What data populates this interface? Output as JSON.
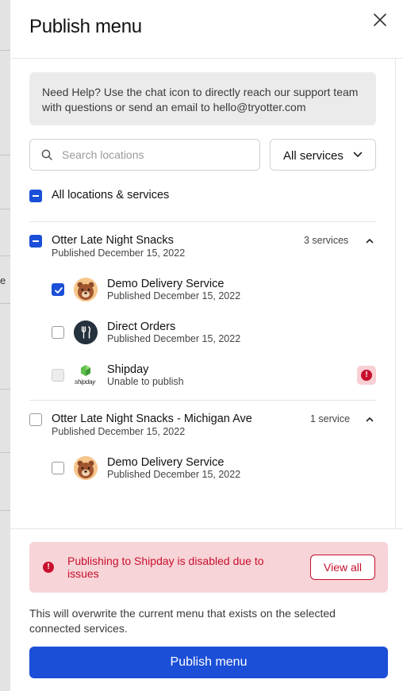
{
  "backdrop": {
    "clipped_text": "e"
  },
  "header": {
    "title": "Publish menu"
  },
  "help": {
    "text": "Need Help? Use the chat icon to directly reach our support team with questions or send an email to hello@tryotter.com"
  },
  "search": {
    "placeholder": "Search locations",
    "value": ""
  },
  "services_filter": {
    "selected": "All services"
  },
  "select_all": {
    "label": "All locations & services",
    "state": "indeterminate"
  },
  "locations": [
    {
      "name": "Otter Late Night Snacks",
      "published": "Published December 15, 2022",
      "count": "3 services",
      "state": "indeterminate",
      "expanded": true,
      "services": [
        {
          "name": "Demo Delivery Service",
          "status": "Published December 15, 2022",
          "checked": true,
          "icon": "bear-avatar-icon"
        },
        {
          "name": "Direct Orders",
          "status": "Published December 15, 2022",
          "checked": false,
          "icon": "fork-knife-icon"
        },
        {
          "name": "Shipday",
          "status": "Unable to publish",
          "checked": false,
          "disabled": true,
          "icon": "shipday-logo-icon",
          "warning": "!",
          "logo_text": "shipday"
        }
      ]
    },
    {
      "name": "Otter Late Night Snacks - Michigan Ave",
      "published": "Published December 15, 2022",
      "count": "1 service",
      "state": "unchecked",
      "expanded": true,
      "services": [
        {
          "name": "Demo Delivery Service",
          "status": "Published December 15, 2022",
          "checked": false,
          "icon": "bear-avatar-icon"
        }
      ]
    }
  ],
  "footer": {
    "alert_icon": "!",
    "alert_text": "Publishing to Shipday is disabled due to issues",
    "view_all": "View all",
    "note": "This will overwrite the current menu that exists on the selected connected services.",
    "publish_label": "Publish menu"
  },
  "colors": {
    "primary": "#1b4fd8",
    "error": "#c8102e",
    "error_bg": "#f7d4d7"
  }
}
